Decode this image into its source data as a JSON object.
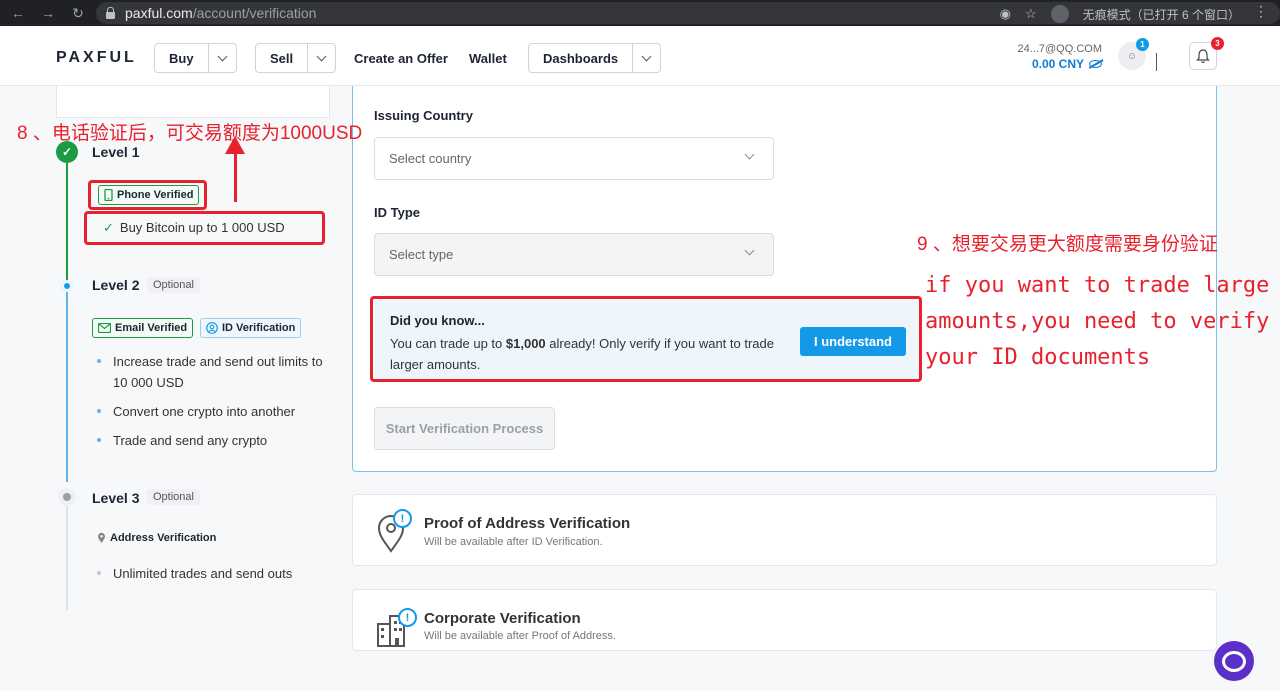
{
  "browser": {
    "url_host": "paxful.com",
    "url_path": "/account/verification",
    "incognito_text": "无痕模式（已打开 6 个窗口）"
  },
  "header": {
    "logo": "PAXFUL",
    "buy_label": "Buy",
    "sell_label": "Sell",
    "create_offer_label": "Create an Offer",
    "wallet_label": "Wallet",
    "dashboards_label": "Dashboards",
    "email": "24...7@QQ.COM",
    "balance": "0.00 CNY",
    "avatar_badge": "1",
    "notification_badge": "3"
  },
  "sidebar": {
    "level1": {
      "title": "Level 1",
      "chip": "Phone Verified",
      "bullets": [
        "Buy Bitcoin up to 1 000 USD"
      ]
    },
    "level2": {
      "title": "Level 2",
      "optional": "Optional",
      "chips": [
        "Email Verified",
        "ID Verification"
      ],
      "bullets": [
        "Increase trade and send out limits to 10 000 USD",
        "Convert one crypto into another",
        "Trade and send any crypto"
      ]
    },
    "level3": {
      "title": "Level 3",
      "optional": "Optional",
      "chip": "Address Verification",
      "bullets": [
        "Unlimited trades and send outs"
      ]
    }
  },
  "form": {
    "country_label": "Issuing Country",
    "country_placeholder": "Select country",
    "idtype_label": "ID Type",
    "idtype_placeholder": "Select type",
    "notice_title": "Did you know...",
    "notice_prefix": "You can trade up to ",
    "notice_amount": "$1,000",
    "notice_suffix": " already! Only verify if you want to trade larger amounts.",
    "understand_button": "I understand",
    "start_button": "Start Verification Process"
  },
  "cards": [
    {
      "title": "Proof of Address Verification",
      "subtitle": "Will be available after ID Verification."
    },
    {
      "title": "Corporate Verification",
      "subtitle": "Will be available after Proof of Address."
    }
  ],
  "annotations": {
    "step8": "8 、电话验证后，可交易额度为1000USD",
    "step9": "9 、想要交易更大额度需要身份验证",
    "step9_en": [
      "if you want to trade large",
      "amounts,you need to verify",
      "your ID documents"
    ]
  },
  "colors": {
    "accent": "#129ae8",
    "success": "#1c9a44",
    "annotation": "#e8212e"
  }
}
